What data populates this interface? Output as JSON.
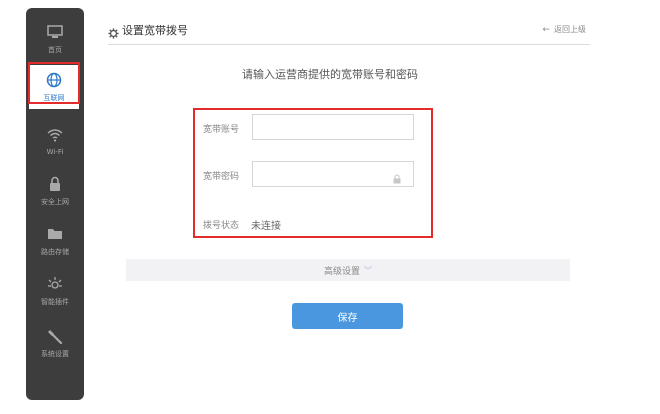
{
  "sidebar": {
    "items": [
      {
        "label": "首页",
        "icon": "home-icon"
      },
      {
        "label": "互联网",
        "icon": "globe-icon"
      },
      {
        "label": "Wi-Fi",
        "icon": "wifi-icon"
      },
      {
        "label": "安全上网",
        "icon": "lock-icon"
      },
      {
        "label": "路由存储",
        "icon": "folder-icon"
      },
      {
        "label": "智能插件",
        "icon": "plugin-icon"
      },
      {
        "label": "系统设置",
        "icon": "wrench-icon"
      }
    ],
    "active_index": 1
  },
  "header": {
    "title": "设置宽带拨号",
    "back_label": "返回上级"
  },
  "main": {
    "subtitle": "请输入运营商提供的宽带账号和密码",
    "account_label": "宽带账号",
    "account_value": "",
    "password_label": "宽带密码",
    "password_value": "",
    "status_label": "拨号状态",
    "status_value": "未连接",
    "advanced_label": "高级设置",
    "save_label": "保存"
  },
  "colors": {
    "sidebar_bg": "#3d3d3d",
    "accent": "#4a97df",
    "highlight": "#e32b2b"
  }
}
